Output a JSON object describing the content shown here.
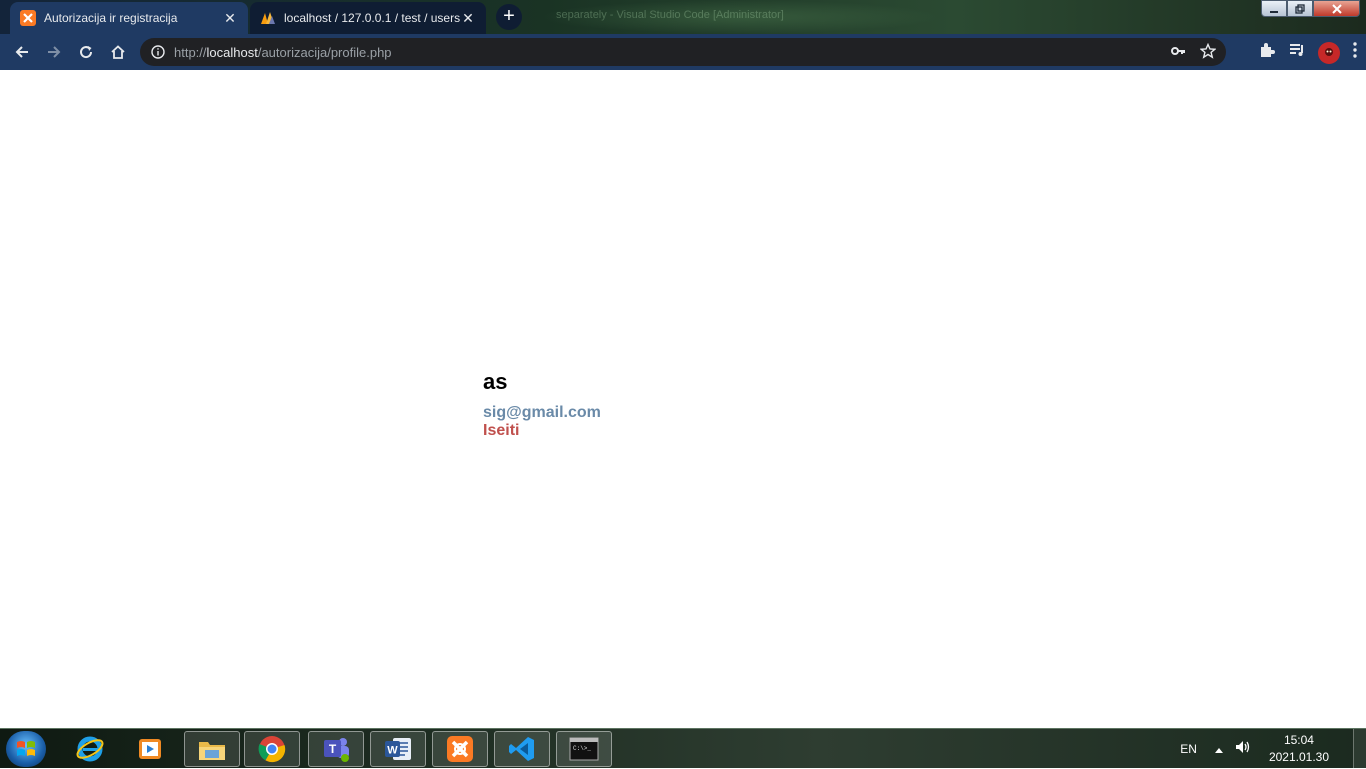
{
  "browser": {
    "tabs": [
      {
        "title": "Autorizacija ir registracija",
        "favicon": "xampp-icon",
        "active": true
      },
      {
        "title": "localhost / 127.0.0.1 / test / users",
        "favicon": "phpmyadmin-icon",
        "active": false
      }
    ],
    "new_tab_label": "+",
    "address": {
      "scheme": "http://",
      "host": "localhost",
      "path": "/autorizacija/profile.php"
    },
    "window_title_faded": "separately - Visual Studio Code [Administrator]",
    "accent_color": "#1f3a63"
  },
  "page": {
    "username": "as",
    "email": "sig@gmail.com",
    "logout_label": "Iseiti",
    "email_color": "#6a8aa8",
    "logout_color": "#c0504d"
  },
  "taskbar": {
    "apps": [
      {
        "name": "internet-explorer-icon",
        "open": false
      },
      {
        "name": "media-player-icon",
        "open": false
      },
      {
        "name": "file-explorer-icon",
        "open": true
      },
      {
        "name": "chrome-icon",
        "open": true
      },
      {
        "name": "teams-icon",
        "open": true
      },
      {
        "name": "word-icon",
        "open": true
      },
      {
        "name": "xampp-icon",
        "open": true
      },
      {
        "name": "vscode-icon",
        "open": true
      },
      {
        "name": "cmd-icon",
        "open": true
      }
    ],
    "language": "EN",
    "time": "15:04",
    "date": "2021.01.30"
  }
}
